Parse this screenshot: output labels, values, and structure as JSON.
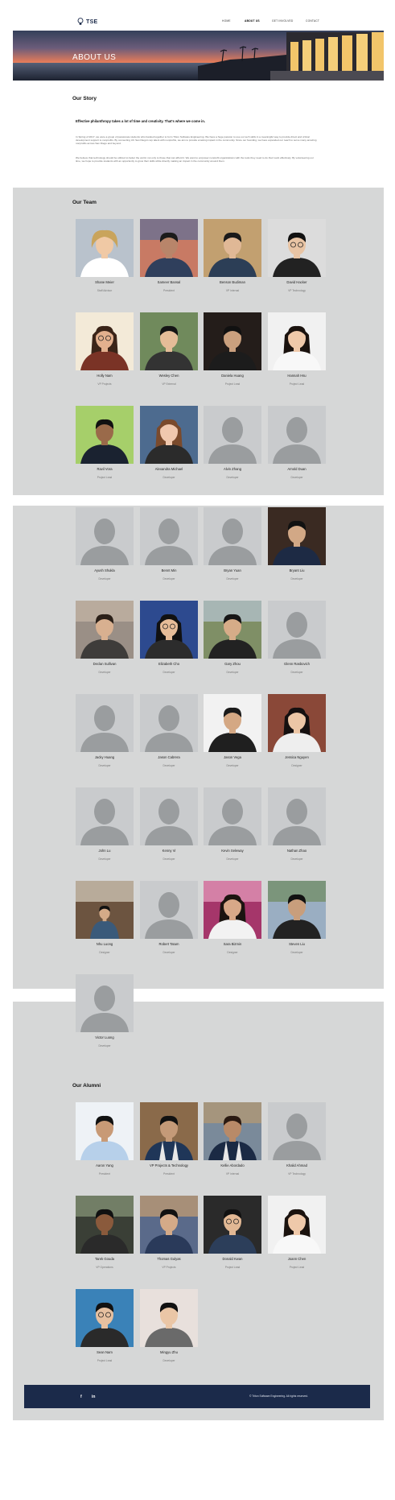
{
  "brand": {
    "name": "TSE"
  },
  "nav": [
    {
      "label": "HOME",
      "active": false
    },
    {
      "label": "ABOUT US",
      "active": true
    },
    {
      "label": "GET INVOLVED",
      "active": false
    },
    {
      "label": "CONTACT",
      "active": false
    }
  ],
  "hero": {
    "title": "ABOUT US"
  },
  "story": {
    "heading": "Our Story",
    "tagline": "Effective philanthropy takes a lot of time and creativity. That's where we come in.",
    "p1": "In Spring of 2017, we were a group of passionate students who banded together to form Triton Software Engineering. We have a huge passion to use our tech skills in a meaningful way to provide direct and critical development support to nonprofits. By connecting UC San Diego's top talent with nonprofits, we aim to provide a lasting impact in the community. Since our founding, we have expanded our reach to serve many amazing nonprofits across San Diego and beyond.",
    "p2": "We believe that technology should be utilized to better the world, not only to those that can afford it. We want to empower nonprofit organizations with the tools they need to do their work effectively. By volunteering our time, we hope to provide students with an opportunity to grow their skills while directly making an impact in the community around them."
  },
  "team": {
    "heading": "Our Team",
    "members": [
      {
        "name": "Shane Meier",
        "role": "Staff Advisor",
        "photo": "curly-blond-hair"
      },
      {
        "name": "Sameer Bansal",
        "role": "President",
        "photo": "sunset-outdoor"
      },
      {
        "name": "Benson Budiman",
        "role": "VP Internal",
        "photo": "grass-outdoor"
      },
      {
        "name": "David Hacker",
        "role": "VP Technology",
        "photo": "studio-glasses"
      },
      {
        "name": "Holly Nam",
        "role": "VP Projects",
        "photo": "long-hair-glasses"
      },
      {
        "name": "Wesley Chen",
        "role": "VP External",
        "photo": "park-outdoor"
      },
      {
        "name": "Daniela Huang",
        "role": "Project Lead",
        "photo": "dark-studio"
      },
      {
        "name": "Hannah Hsu",
        "role": "Project Lead",
        "photo": "long-hair-light"
      },
      {
        "name": "Ravil Vora",
        "role": "Project Lead",
        "photo": "green-backdrop-suit"
      },
      {
        "name": "Alexandra Michael",
        "role": "Developer",
        "photo": "blue-backdrop"
      },
      {
        "name": "Alvin Zhang",
        "role": "Developer",
        "photo": "placeholder"
      },
      {
        "name": "Arnold Duan",
        "role": "Developer",
        "photo": "placeholder"
      },
      {
        "name": "Ayush Shukla",
        "role": "Developer",
        "photo": "placeholder"
      },
      {
        "name": "Bennt Min",
        "role": "Developer",
        "photo": "placeholder"
      },
      {
        "name": "Bryan Yuan",
        "role": "Developer",
        "photo": "placeholder"
      },
      {
        "name": "Bryant Liu",
        "role": "Developer",
        "photo": "dark-wall"
      },
      {
        "name": "Declan Sullivan",
        "role": "Developer",
        "photo": "mountain-outdoor"
      },
      {
        "name": "Elizabeth Cho",
        "role": "Developer",
        "photo": "blue-glasses"
      },
      {
        "name": "Gary Zhou",
        "role": "Developer",
        "photo": "hills-outdoor"
      },
      {
        "name": "Glenn Rasbovich",
        "role": "Developer",
        "photo": "placeholder"
      },
      {
        "name": "Jacky Huang",
        "role": "Developer",
        "photo": "placeholder"
      },
      {
        "name": "Jason Cabrera",
        "role": "Developer",
        "photo": "placeholder"
      },
      {
        "name": "Jason Vega",
        "role": "Developer",
        "photo": "white-wall-suit"
      },
      {
        "name": "Jessica Nguyen",
        "role": "Designer",
        "photo": "brick-wall"
      },
      {
        "name": "John Lu",
        "role": "Developer",
        "photo": "placeholder"
      },
      {
        "name": "Kenny Vi",
        "role": "Developer",
        "photo": "placeholder"
      },
      {
        "name": "Kevin Seleway",
        "role": "Developer",
        "photo": "placeholder"
      },
      {
        "name": "Nathan Zhao",
        "role": "Developer",
        "photo": "placeholder"
      },
      {
        "name": "Nhu Luong",
        "role": "Designer",
        "photo": "bridge-outdoor"
      },
      {
        "name": "Robert Tatum",
        "role": "Developer",
        "photo": "placeholder"
      },
      {
        "name": "Sara Bizmin",
        "role": "Designer",
        "photo": "flowers"
      },
      {
        "name": "Steven Liu",
        "role": "Developer",
        "photo": "waterfall"
      },
      {
        "name": "Victor Luong",
        "role": "Developer",
        "photo": "placeholder"
      }
    ]
  },
  "alumni": {
    "heading": "Our Alumni",
    "members": [
      {
        "name": "Aaron Yang",
        "role": "President",
        "photo": "white-wall-shirt"
      },
      {
        "name": "VP Projects & Technology",
        "role": "President",
        "photo": "stole-graduation"
      },
      {
        "name": "Kellie Abordado",
        "role": "VP Internal",
        "photo": "cliff-graduation"
      },
      {
        "name": "Khalid Ahmad",
        "role": "VP Technology",
        "photo": "placeholder"
      },
      {
        "name": "Tarek Gouda",
        "role": "VP Operations",
        "photo": "dark-outdoor"
      },
      {
        "name": "Thomas Gulyas",
        "role": "VP Projects",
        "photo": "night-city"
      },
      {
        "name": "Donald Kwan",
        "role": "Project Lead",
        "photo": "studio-glasses-dark"
      },
      {
        "name": "Joann Chen",
        "role": "Project Lead",
        "photo": "long-hair-light"
      },
      {
        "name": "Sean Nam",
        "role": "Project Lead",
        "photo": "blue-glasses-male"
      },
      {
        "name": "Mingyu Zhu",
        "role": "Developer",
        "photo": "studio-light"
      }
    ]
  },
  "footer": {
    "social": [
      "f",
      "in"
    ],
    "copyright": "© Triton Software Engineering. All rights reserved."
  },
  "colors": {
    "navy": "#1b2a4a",
    "section_gray": "#d6d7d7",
    "placeholder_bg": "#c9cbcd",
    "placeholder_fg": "#9a9d9f"
  }
}
